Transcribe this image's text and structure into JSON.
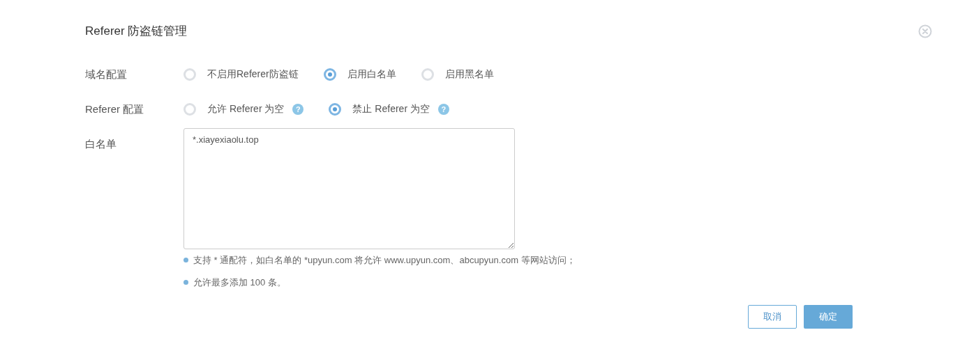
{
  "dialog": {
    "title": "Referer 防盗链管理"
  },
  "rows": [
    {
      "label": "域名配置",
      "kind": "radio",
      "options": [
        {
          "label": "不启用Referer防盗链",
          "selected": false
        },
        {
          "label": "启用白名单",
          "selected": true
        },
        {
          "label": "启用黑名单",
          "selected": false
        }
      ]
    },
    {
      "label": "Referer 配置",
      "kind": "radio",
      "options": [
        {
          "label": "允许 Referer 为空",
          "selected": false,
          "help": "?"
        },
        {
          "label": "禁止 Referer 为空",
          "selected": true,
          "help": "?"
        }
      ]
    },
    {
      "label": "白名单",
      "kind": "textarea",
      "value": "*.xiayexiaolu.top",
      "notes": [
        "支持 * 通配符，如白名单的 *upyun.com 将允许 www.upyun.com、abcupyun.com 等网站访问；",
        "允许最多添加 100 条。"
      ]
    }
  ],
  "buttons": [
    {
      "label": "取消",
      "kind": "secondary"
    },
    {
      "label": "确定",
      "kind": "primary"
    }
  ]
}
